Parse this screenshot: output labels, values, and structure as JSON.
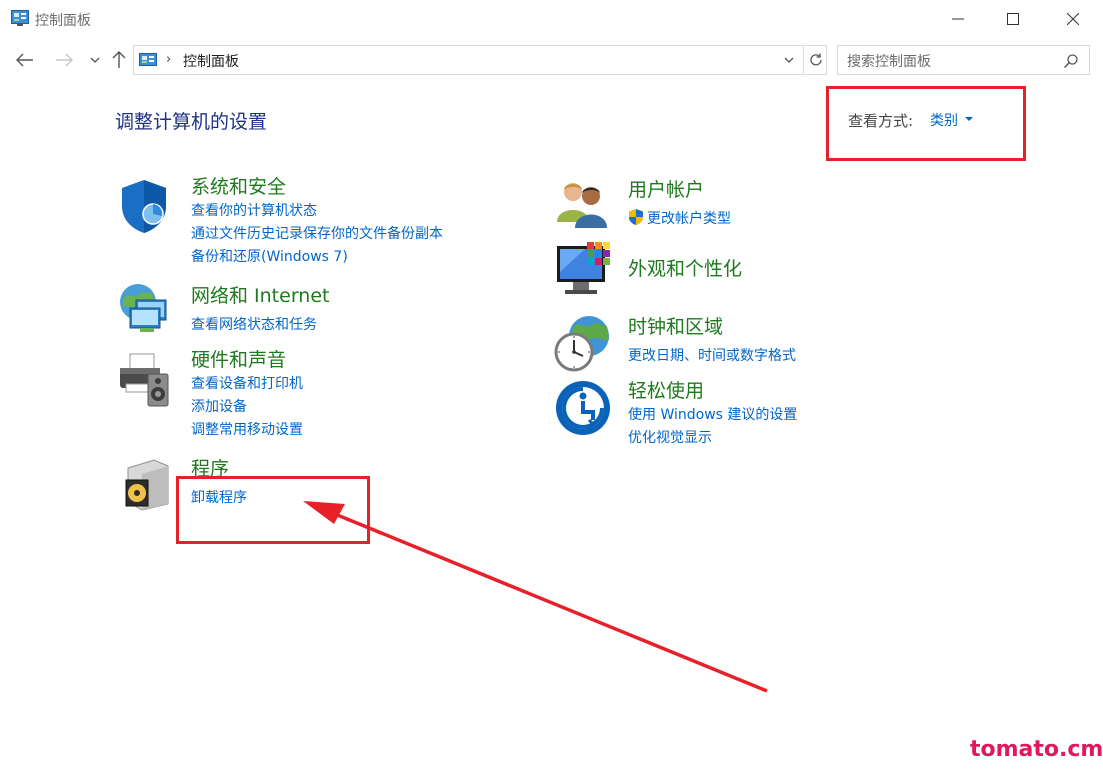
{
  "window": {
    "title": "控制面板"
  },
  "address": {
    "path": "控制面板",
    "separator": "›"
  },
  "search": {
    "placeholder": "搜索控制面板"
  },
  "header": {
    "heading": "调整计算机的设置",
    "view_by_label": "查看方式:",
    "view_by_value": "类别"
  },
  "categories": {
    "security": {
      "title": "系统和安全",
      "links": [
        "查看你的计算机状态",
        "通过文件历史记录保存你的文件备份副本",
        "备份和还原(Windows 7)"
      ],
      "icon": "shield-icon"
    },
    "network": {
      "title": "网络和 Internet",
      "links": [
        "查看网络状态和任务"
      ],
      "icon": "network-globe-icon"
    },
    "hardware": {
      "title": "硬件和声音",
      "links": [
        "查看设备和打印机",
        "添加设备",
        "调整常用移动设置"
      ],
      "icon": "printer-icon"
    },
    "programs": {
      "title": "程序",
      "links": [
        "卸载程序"
      ],
      "icon": "programs-disc-icon"
    },
    "accounts": {
      "title": "用户帐户",
      "links": [
        "更改帐户类型"
      ],
      "icon": "users-icon"
    },
    "appearance": {
      "title": "外观和个性化",
      "links": [],
      "icon": "monitor-colors-icon"
    },
    "clock": {
      "title": "时钟和区域",
      "links": [
        "更改日期、时间或数字格式"
      ],
      "icon": "clock-globe-icon"
    },
    "ease": {
      "title": "轻松使用",
      "links": [
        "使用 Windows 建议的设置",
        "优化视觉显示"
      ],
      "icon": "ease-of-access-icon"
    }
  },
  "annotation": {
    "watermark": "tomato.cm",
    "highlight_color": "#e8202a"
  },
  "colors": {
    "category_title": "#1f7a1f",
    "link": "#0066cc",
    "heading": "#1e3287"
  }
}
